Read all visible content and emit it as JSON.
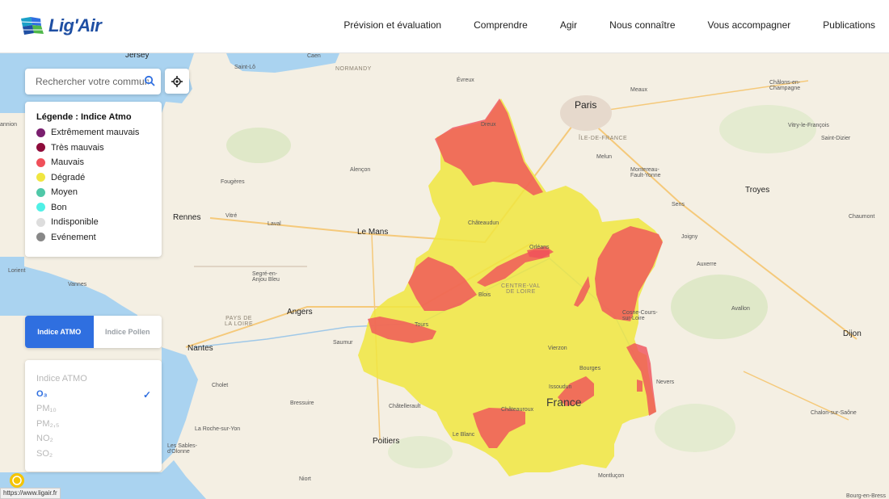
{
  "brand": {
    "name": "Lig'Air"
  },
  "nav": {
    "items": [
      "Prévision et évaluation",
      "Comprendre",
      "Agir",
      "Nous connaître",
      "Vous accompagner",
      "Publications"
    ]
  },
  "search": {
    "placeholder": "Rechercher votre commune"
  },
  "legend": {
    "title": "Légende : Indice Atmo",
    "items": [
      {
        "label": "Extrêmement mauvais",
        "color": "#7a1f6f"
      },
      {
        "label": "Très mauvais",
        "color": "#8e0c3b"
      },
      {
        "label": "Mauvais",
        "color": "#f0505a"
      },
      {
        "label": "Dégradé",
        "color": "#f0e641"
      },
      {
        "label": "Moyen",
        "color": "#50c8a8"
      },
      {
        "label": "Bon",
        "color": "#50f0e6"
      },
      {
        "label": "Indisponible",
        "color": "#dddddd"
      },
      {
        "label": "Evénement",
        "color": "#888888"
      }
    ]
  },
  "index_toggle": {
    "active": "Indice ATMO",
    "inactive": "Indice Pollen"
  },
  "pollutants": {
    "items": [
      "Indice ATMO",
      "O₃",
      "PM₁₀",
      "PM₂,₅",
      "NO₂",
      "SO₂"
    ],
    "selected": "O₃"
  },
  "map": {
    "places": {
      "jersey": "Jersey",
      "caen": "Caen",
      "saint_lo": "Saint-Lô",
      "normandy": "NORMANDY",
      "evreux": "Évreux",
      "paris": "Paris",
      "meaux": "Meaux",
      "chalons": "Châlons-en-\nChampagne",
      "dreux": "Dreux",
      "ile_de_france": "ÎLE-DE-FRANCE",
      "melun": "Melun",
      "vitry": "Vitry-le-François",
      "saint_dizier": "Saint-Dizier",
      "alencon": "Alençon",
      "fougeres": "Fougères",
      "montereau": "Montereau-\nFault-Yonne",
      "troyes": "Troyes",
      "rennes": "Rennes",
      "vitre": "Vitré",
      "laval": "Laval",
      "le_mans": "Le Mans",
      "chateaudun": "Châteaudun",
      "sens": "Sens",
      "chaumont": "Chaumont",
      "lorient": "Lorient",
      "vannes": "Vannes",
      "segre": "Segré-en-\nAnjou Bleu",
      "orleans": "Orléans",
      "joigny": "Joigny",
      "auxerre": "Auxerre",
      "centre": "CENTRE-VAL\nDE LOIRE",
      "blois": "Blois",
      "angers": "Angers",
      "pays_loire": "PAYS DE\nLA LOIRE",
      "cosne": "Cosne-Cours-\nsur-Loire",
      "avallon": "Avallon",
      "tours": "Tours",
      "nantes": "Nantes",
      "saumur": "Saumur",
      "vierzon": "Vierzon",
      "bourges": "Bourges",
      "dijon": "Dijon",
      "cholet": "Cholet",
      "issoudun": "Issoudun",
      "nevers": "Nevers",
      "france": "France",
      "bressuire": "Bressuire",
      "chatellerault": "Châtellerault",
      "chateauroux": "Châteauroux",
      "chalon": "Chalon-sur-Saône",
      "la_roche": "La Roche-sur-Yon",
      "le_blanc": "Le Blanc",
      "poitiers": "Poitiers",
      "sables": "Les Sables-\nd'Olonne",
      "niort": "Niort",
      "montlucon": "Montluçon",
      "bourg": "Bourg-en-Bress",
      "annion": "annion"
    }
  },
  "status_url": "https://www.ligair.fr"
}
